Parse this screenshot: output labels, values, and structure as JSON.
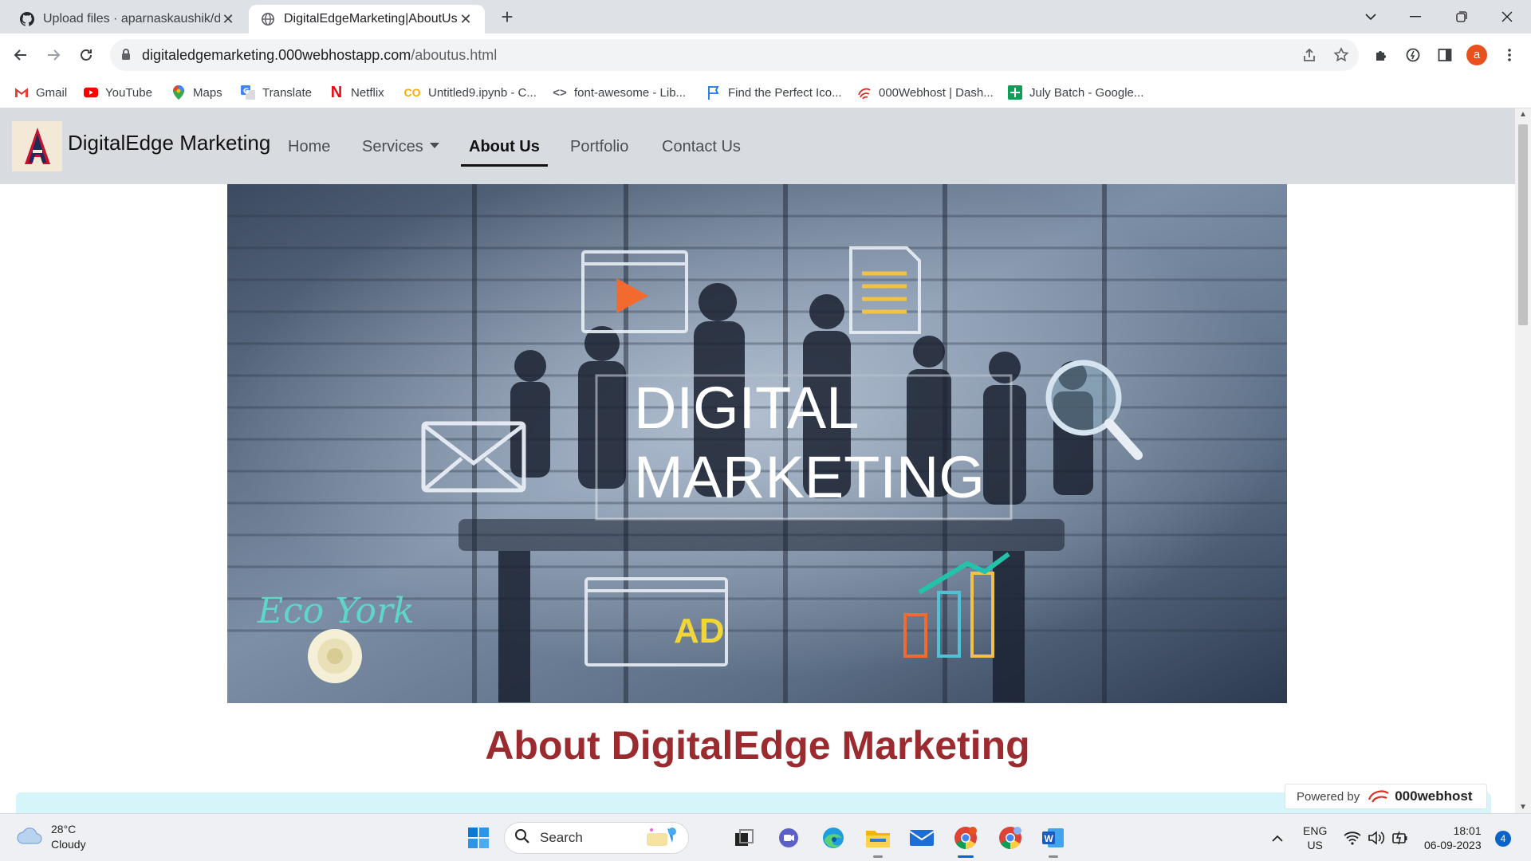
{
  "browser": {
    "tabs": [
      {
        "title": "Upload files · aparnaskaushik/dig"
      },
      {
        "title": "DigitalEdgeMarketing|AboutUs|"
      }
    ],
    "url_host": "digitaledgemarketing.000webhostapp.com",
    "url_path": "/aboutus.html",
    "bookmarks": [
      {
        "label": "Gmail"
      },
      {
        "label": "YouTube"
      },
      {
        "label": "Maps"
      },
      {
        "label": "Translate"
      },
      {
        "label": "Netflix"
      },
      {
        "label": "Untitled9.ipynb - C..."
      },
      {
        "label": "font-awesome - Lib..."
      },
      {
        "label": "Find the Perfect Ico..."
      },
      {
        "label": "000Webhost | Dash..."
      },
      {
        "label": "July Batch - Google..."
      }
    ],
    "profile_initial": "a"
  },
  "site": {
    "brand": "DigitalEdge Marketing",
    "nav": {
      "home": "Home",
      "services": "Services",
      "about": "About Us",
      "portfolio": "Portfolio",
      "contact": "Contact Us"
    },
    "hero": {
      "line1": "DIGITAL",
      "line2": "MARKETING",
      "watermark": "Eco York",
      "ad_text": "AD"
    },
    "about_title": "About DigitalEdge Marketing",
    "powered_by": "Powered by",
    "powered_brand": "000webhost"
  },
  "taskbar": {
    "temperature": "28°C",
    "condition": "Cloudy",
    "search_label": "Search",
    "language": "ENG",
    "region": "US",
    "time": "18:01",
    "date": "06-09-2023",
    "notifications": "4"
  }
}
